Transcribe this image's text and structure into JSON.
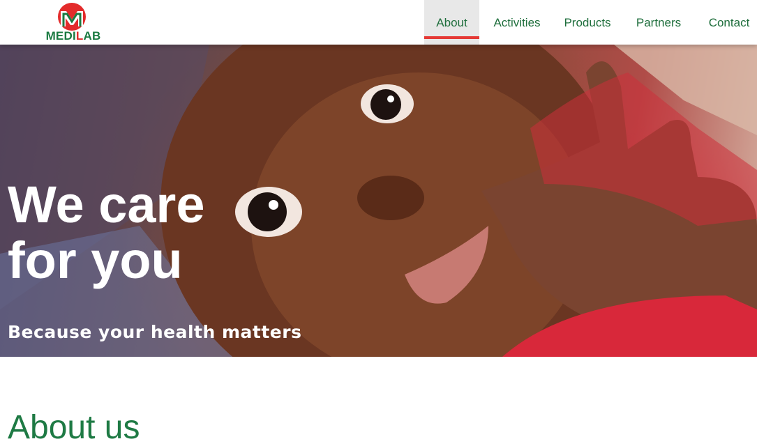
{
  "brand": {
    "name_part1": "MEDI",
    "name_part2": "L",
    "name_part3": "AB",
    "colors": {
      "green": "#1a7a41",
      "red": "#e32b2b"
    }
  },
  "nav": {
    "items": [
      {
        "label": "About",
        "active": true
      },
      {
        "label": "Activities",
        "active": false
      },
      {
        "label": "Products",
        "active": false
      },
      {
        "label": "Partners",
        "active": false
      },
      {
        "label": "Contact",
        "active": false
      }
    ]
  },
  "hero": {
    "title_line1": "We care",
    "title_line2": "for you",
    "subtitle": "Because your health matters"
  },
  "about": {
    "heading": "About us"
  }
}
